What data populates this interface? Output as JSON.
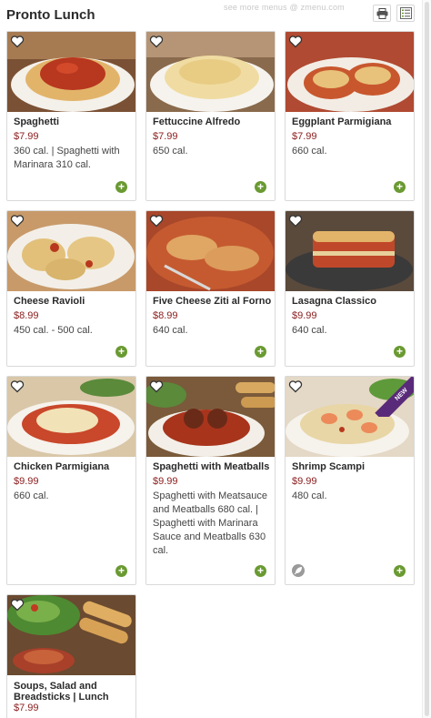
{
  "page": {
    "title": "Pronto Lunch",
    "watermark": "see more menus @ zmenu.com"
  },
  "header": {
    "print_icon": "printer-icon",
    "list_icon": "list-view-icon"
  },
  "items": [
    {
      "name": "Spaghetti",
      "price": "$7.99",
      "calories": "360 cal. | Spaghetti with Marinara 310 cal."
    },
    {
      "name": "Fettuccine Alfredo",
      "price": "$7.99",
      "calories": "650 cal."
    },
    {
      "name": "Eggplant Parmigiana",
      "price": "$7.99",
      "calories": "660 cal."
    },
    {
      "name": "Cheese Ravioli",
      "price": "$8.99",
      "calories": "450 cal. - 500 cal."
    },
    {
      "name": "Five Cheese Ziti al Forno",
      "price": "$8.99",
      "calories": "640 cal."
    },
    {
      "name": "Lasagna Classico",
      "price": "$9.99",
      "calories": "640 cal."
    },
    {
      "name": "Chicken Parmigiana",
      "price": "$9.99",
      "calories": "660 cal."
    },
    {
      "name": "Spaghetti with Meatballs",
      "price": "$9.99",
      "calories": "Spaghetti with Meatsauce and Meatballs 680 cal. | Spaghetti with Marinara Sauce and Meatballs 630 cal."
    },
    {
      "name": "Shrimp Scampi",
      "price": "$9.99",
      "calories": "480 cal.",
      "badge": "NEW"
    },
    {
      "name": "Soups, Salad and Breadsticks | Lunch",
      "price": "$7.99",
      "calories": ""
    }
  ],
  "icons": {
    "favorite": "heart-icon",
    "add": "plus-icon",
    "vegetarian": "leaf-icon"
  },
  "colors": {
    "price": "#8a1b1b",
    "add_button": "#6a9a32",
    "new_badge": "#5a2a7a"
  }
}
